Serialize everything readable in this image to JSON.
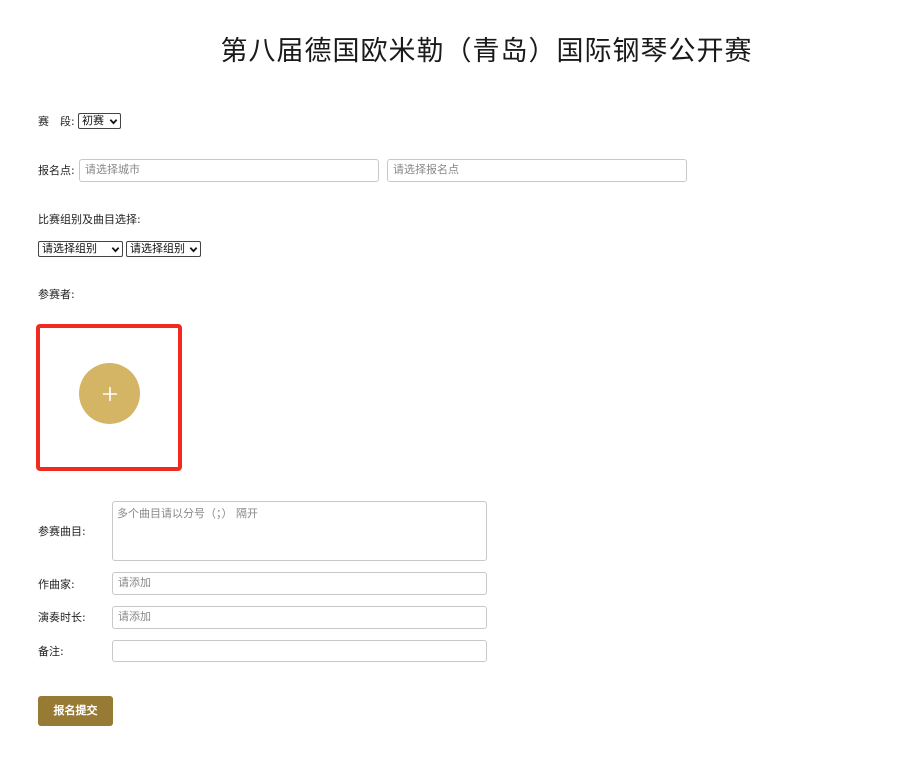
{
  "page": {
    "title": "第八届德国欧米勒（青岛）国际钢琴公开赛"
  },
  "stage": {
    "label": "赛　段:",
    "selected": "初赛"
  },
  "registration_point": {
    "label": "报名点:",
    "city_placeholder": "请选择城市",
    "point_placeholder": "请选择报名点"
  },
  "group_selection": {
    "label": "比赛组别及曲目选择:",
    "group_select_1": "请选择组别",
    "group_select_2": "请选择组别"
  },
  "participants": {
    "label": "参赛者:",
    "add_button_icon": "plus-icon",
    "add_button_color": "#d4b565",
    "highlight_color": "#f02a1e"
  },
  "pieces": {
    "label": "参赛曲目:",
    "placeholder": "多个曲目请以分号（；） 隔开"
  },
  "composer": {
    "label": "作曲家:",
    "placeholder": "请添加"
  },
  "duration": {
    "label": "演奏时长:",
    "placeholder": "请添加"
  },
  "remarks": {
    "label": "备注:",
    "placeholder": ""
  },
  "submit": {
    "label": "报名提交",
    "color": "#977a33"
  }
}
